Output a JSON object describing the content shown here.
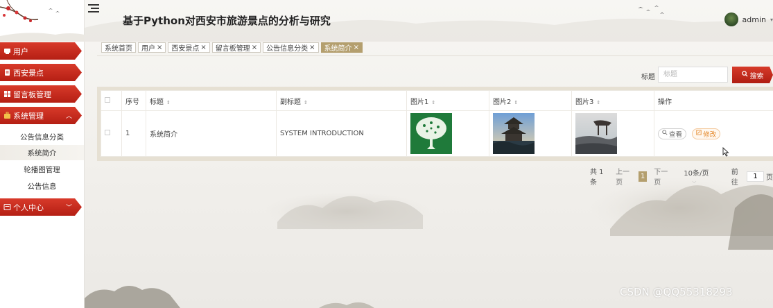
{
  "header": {
    "title": "基于Python对西安市旅游景点的分析与研究",
    "user": "admin",
    "menu_icon": "hamburger-icon"
  },
  "sidebar": {
    "items": [
      {
        "label": "用户",
        "icon": "user-card-icon"
      },
      {
        "label": "西安景点",
        "icon": "clipboard-icon"
      },
      {
        "label": "留言板管理",
        "icon": "grid-icon"
      },
      {
        "label": "系统管理",
        "icon": "briefcase-icon",
        "expanded": true
      },
      {
        "label": "个人中心",
        "icon": "profile-icon"
      }
    ],
    "sub_items": [
      "公告信息分类",
      "系统简介",
      "轮播图管理",
      "公告信息"
    ],
    "active_sub": "系统简介"
  },
  "tabs": [
    {
      "label": "系统首页",
      "closable": false
    },
    {
      "label": "用户",
      "closable": true
    },
    {
      "label": "西安景点",
      "closable": true
    },
    {
      "label": "留言板管理",
      "closable": true
    },
    {
      "label": "公告信息分类",
      "closable": true
    },
    {
      "label": "系统简介",
      "closable": true,
      "active": true
    }
  ],
  "tab_close_glyph": "×",
  "search": {
    "label": "标题",
    "placeholder": "标题",
    "button_label": "搜索"
  },
  "table": {
    "headers": [
      "序号",
      "标题",
      "副标题",
      "图片1",
      "图片2",
      "图片3",
      "操作"
    ],
    "rows": [
      {
        "index": "1",
        "title": "系统简介",
        "subtitle": "SYSTEM INTRODUCTION",
        "images": [
          "tree-image",
          "pagoda-image",
          "pavilion-image"
        ]
      }
    ],
    "actions": {
      "view": "查看",
      "edit": "修改"
    }
  },
  "pagination": {
    "total": "共 1 条",
    "prev": "上一页",
    "current": "1",
    "next": "下一页",
    "page_size": "10条/页",
    "goto_label": "前往",
    "goto_value": "1",
    "goto_unit": "页"
  },
  "watermark": "CSDN @QQ55318293",
  "colors": {
    "primary_red": "#c0281c",
    "accent_gold": "#b49f6e",
    "edit_orange": "#e58a2e"
  }
}
